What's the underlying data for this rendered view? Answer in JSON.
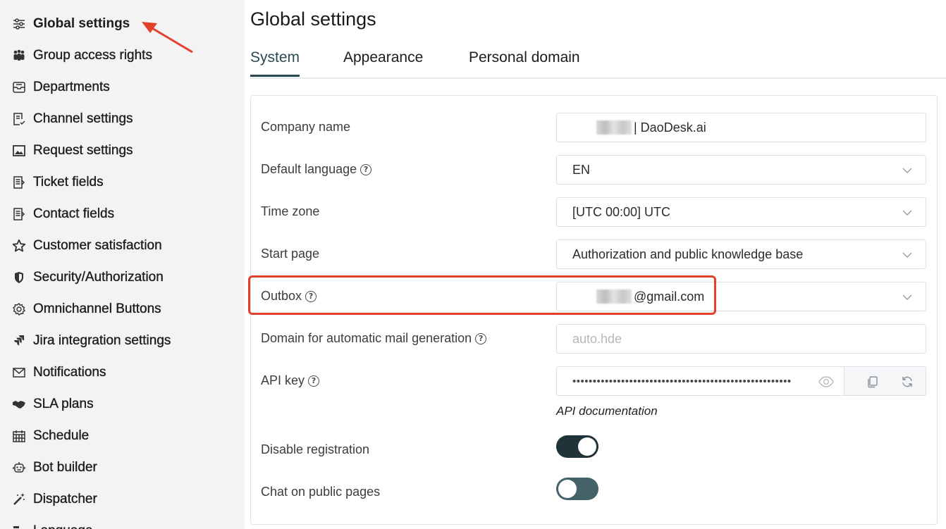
{
  "sidebar": {
    "items": [
      {
        "label": "Global settings",
        "icon": "sliders-icon",
        "active": true
      },
      {
        "label": "Group access rights",
        "icon": "group-icon"
      },
      {
        "label": "Departments",
        "icon": "inbox-icon"
      },
      {
        "label": "Channel settings",
        "icon": "checklist-icon"
      },
      {
        "label": "Request settings",
        "icon": "image-icon"
      },
      {
        "label": "Ticket fields",
        "icon": "document-icon"
      },
      {
        "label": "Contact fields",
        "icon": "document-icon"
      },
      {
        "label": "Customer satisfaction",
        "icon": "star-icon"
      },
      {
        "label": "Security/Authorization",
        "icon": "shield-icon"
      },
      {
        "label": "Omnichannel Buttons",
        "icon": "gear-icon"
      },
      {
        "label": "Jira integration settings",
        "icon": "jira-icon"
      },
      {
        "label": "Notifications",
        "icon": "mail-icon"
      },
      {
        "label": "SLA plans",
        "icon": "handshake-icon"
      },
      {
        "label": "Schedule",
        "icon": "calendar-icon"
      },
      {
        "label": "Bot builder",
        "icon": "robot-icon"
      },
      {
        "label": "Dispatcher",
        "icon": "magic-wand-icon"
      },
      {
        "label": "Language",
        "icon": "language-icon"
      }
    ]
  },
  "header": {
    "title": "Global settings",
    "tabs": [
      "System",
      "Appearance",
      "Personal domain"
    ],
    "active_tab": "System"
  },
  "form": {
    "company_name": {
      "label": "Company name",
      "value": "| DaoDesk.ai"
    },
    "default_language": {
      "label": "Default language",
      "value": "EN"
    },
    "time_zone": {
      "label": "Time zone",
      "value": "[UTC 00:00] UTC"
    },
    "start_page": {
      "label": "Start page",
      "value": "Authorization and public knowledge base"
    },
    "outbox": {
      "label": "Outbox",
      "value": "@gmail.com"
    },
    "mail_domain": {
      "label": "Domain for automatic mail generation",
      "placeholder": "auto.hde",
      "value": ""
    },
    "api_key": {
      "label": "API key",
      "value": "••••••••••••••••••••••••••••••••••••••••••••••••••••••"
    },
    "api_doc_link": "API documentation",
    "disable_registration": {
      "label": "Disable registration",
      "on": true
    },
    "chat_public": {
      "label": "Chat on public pages",
      "on": false
    }
  },
  "colors": {
    "accent": "#2a4a52",
    "highlight": "#e2402b",
    "sidebar_bg": "#f3f3f3",
    "toggle_on": "#1f3338",
    "toggle_off": "#456268"
  }
}
